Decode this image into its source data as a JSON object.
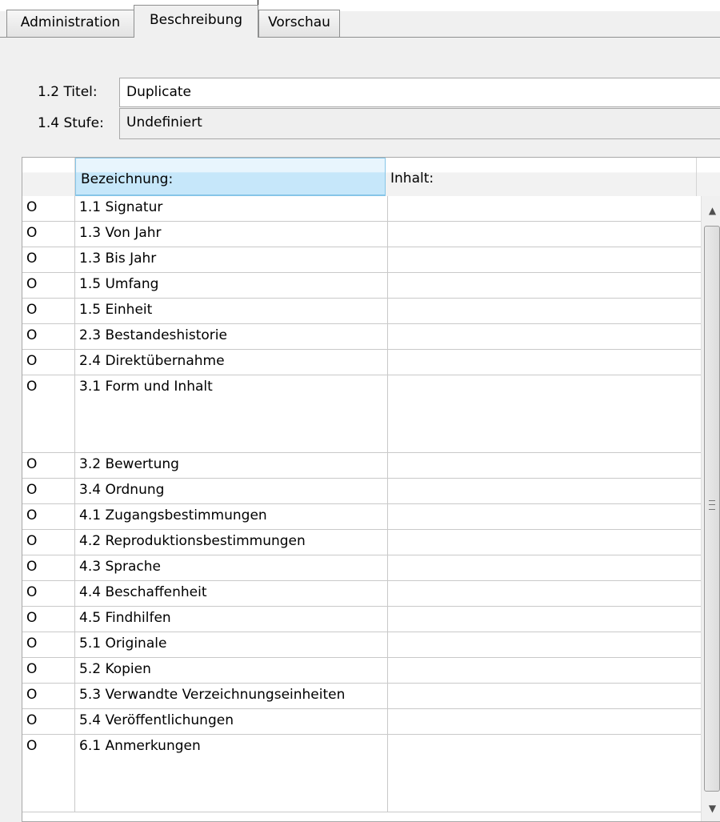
{
  "tabs": [
    {
      "label": "Administration",
      "active": false
    },
    {
      "label": "Beschreibung",
      "active": true
    },
    {
      "label": "Vorschau",
      "active": false
    }
  ],
  "fields": {
    "title_label": "1.2 Titel:",
    "title_value": "Duplicate",
    "level_label": "1.4 Stufe:",
    "level_value": "Undefiniert"
  },
  "table": {
    "headers": [
      "",
      "Bezeichnung:",
      "Inhalt:"
    ],
    "rows": [
      {
        "marker": "O",
        "name": "1.1 Signatur",
        "content": ""
      },
      {
        "marker": "O",
        "name": "1.3 Von Jahr",
        "content": ""
      },
      {
        "marker": "O",
        "name": "1.3 Bis Jahr",
        "content": ""
      },
      {
        "marker": "O",
        "name": "1.5 Umfang",
        "content": ""
      },
      {
        "marker": "O",
        "name": "1.5 Einheit",
        "content": ""
      },
      {
        "marker": "O",
        "name": "2.3 Bestandeshistorie",
        "content": ""
      },
      {
        "marker": "O",
        "name": "2.4 Direktübernahme",
        "content": ""
      },
      {
        "marker": "O",
        "name": "3.1 Form und Inhalt",
        "content": "",
        "tall": true
      },
      {
        "marker": "O",
        "name": "3.2 Bewertung",
        "content": ""
      },
      {
        "marker": "O",
        "name": "3.4 Ordnung",
        "content": ""
      },
      {
        "marker": "O",
        "name": "4.1 Zugangsbestimmungen",
        "content": ""
      },
      {
        "marker": "O",
        "name": "4.2 Reproduktionsbestimmungen",
        "content": ""
      },
      {
        "marker": "O",
        "name": "4.3 Sprache",
        "content": ""
      },
      {
        "marker": "O",
        "name": "4.4 Beschaffenheit",
        "content": ""
      },
      {
        "marker": "O",
        "name": "4.5 Findhilfen",
        "content": ""
      },
      {
        "marker": "O",
        "name": "5.1 Originale",
        "content": ""
      },
      {
        "marker": "O",
        "name": "5.2 Kopien",
        "content": ""
      },
      {
        "marker": "O",
        "name": "5.3 Verwandte Verzeichnungseinheiten",
        "content": ""
      },
      {
        "marker": "O",
        "name": "5.4 Veröffentlichungen",
        "content": ""
      },
      {
        "marker": "O",
        "name": "6.1 Anmerkungen",
        "content": "",
        "tall": true
      }
    ]
  },
  "scrollbar": {
    "up_icon": "arrow-up-icon",
    "down_icon": "arrow-down-icon"
  }
}
